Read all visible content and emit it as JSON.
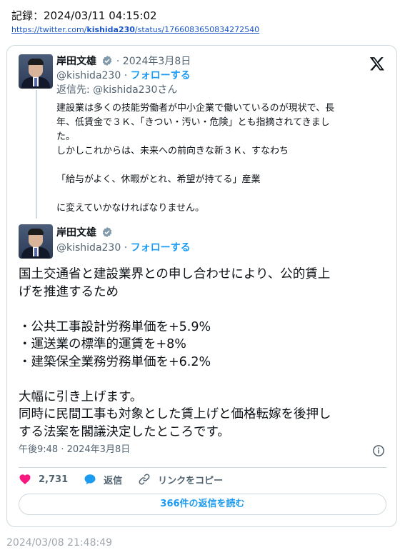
{
  "archive": {
    "record_label": "記録：2024/03/11 04:15:02",
    "url_prefix": "https://twitter.com/",
    "url_handle": "kishida230",
    "url_suffix": "/status/1766083650834272540"
  },
  "quoted_tweet": {
    "author_name": "岸田文雄",
    "date": "· 2024年3月8日",
    "handle": "@kishida230",
    "separator": " · ",
    "follow_label": "フォローする",
    "reply_to": "返信先: @kishida230さん",
    "lines": [
      "建設業は多くの技能労働者が中小企業で働いているのが現状で、長",
      "年、低賃金で３Ｋ、「きつい・汚い・危険」とも指摘されてきまし",
      "た。",
      "しかしこれからは、未来への前向きな新３Ｋ、すなわち",
      "",
      "「給与がよく、休暇がとれ、希望が持てる」産業",
      "",
      "に変えていかなければなりません。"
    ]
  },
  "main_tweet": {
    "author_name": "岸田文雄",
    "handle": "@kishida230",
    "separator": " · ",
    "follow_label": "フォローする",
    "lines": [
      "国土交通省と建設業界との申し合わせにより、公的賃上",
      "げを推進するため",
      "",
      "・公共工事設計労務単価を+5.9%",
      "・運送業の標準的運賃を+8%",
      "・建築保全業務労務単価を+6.2%",
      "",
      "大幅に引き上げます。",
      "同時に民間工事も対象とした賃上げと価格転嫁を後押し",
      "する法案を閣議決定したところです。"
    ],
    "timestamp": "午後9:48 · 2024年3月8日",
    "like_count": "2,731",
    "reply_label": "返信",
    "copy_link_label": "リンクをコピー",
    "read_replies_label": "366件の返信を読む"
  },
  "capture_time": "2024/03/08 21:48:49",
  "colors": {
    "accent": "#1d9bf0",
    "like": "#f91880",
    "muted": "#536471",
    "border": "#cfd9de"
  },
  "icons": {
    "x_logo": "x-logo-icon",
    "verified": "verified-badge-icon",
    "info": "info-icon",
    "like": "heart-icon",
    "reply": "speech-bubble-icon",
    "copy_link": "link-icon"
  }
}
